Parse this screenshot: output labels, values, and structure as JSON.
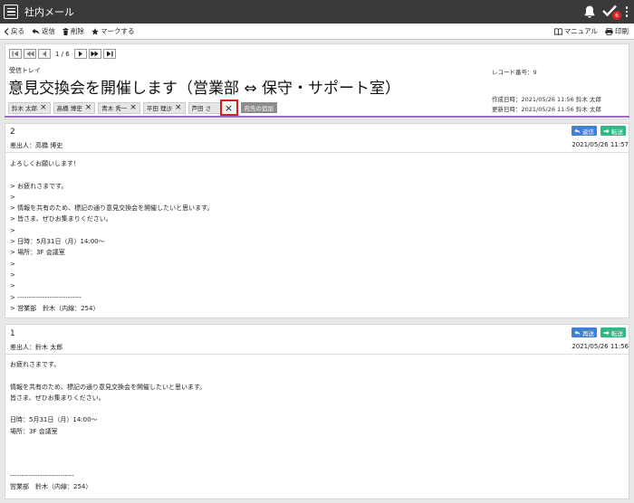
{
  "app": {
    "title": "社内メール",
    "badge_count": "6"
  },
  "toolbar": {
    "back": "戻る",
    "reply": "返信",
    "delete": "削除",
    "mark": "マークする",
    "manual": "マニュアル",
    "print": "印刷"
  },
  "pager": {
    "page": "1 / 6"
  },
  "mail": {
    "tray": "受信トレイ",
    "subject": "意見交換会を開催します（営業部 ⇔ 保守・サポート室）",
    "record_no": "レコード番号：9",
    "created": "作成日時：2021/05/26 11:56 鈴木 太郎",
    "updated": "更新日時：2021/05/26 11:56 鈴木 太郎",
    "recipients": [
      "鈴木 太郎",
      "高橋 博史",
      "青木 秀一",
      "平田 理沙",
      "芦田 さ"
    ],
    "add_destination": "宛先の追加"
  },
  "messages": [
    {
      "number": "2",
      "from": "差出人：高橋 博史",
      "date": "2021/05/26 11:57",
      "reply_label": "返信",
      "forward_label": "転送",
      "body": "よろしくお願いします！\n\n> お疲れさまです。\n>\n> 情報を共有のため、標記の通り意見交換会を開催したいと思います。\n> 皆さま、ぜひお集まりください。\n>\n> 日時：5月31日（月）14:00～\n> 場所：3F 会議室\n>\n>\n>\n> ----------------------------\n> 営業部　鈴木（内線：254）"
    },
    {
      "number": "1",
      "from": "差出人：鈴木 太郎",
      "date": "2021/05/26 11:56",
      "reply_label": "再送",
      "forward_label": "転送",
      "body": "お疲れさまです。\n\n情報を共有のため、標記の通り意見交換会を開催したいと思います。\n皆さま、ぜひお集まりください。\n\n日時：5月31日（月）14:00～\n場所：3F 会議室\n\n\n\n----------------------------\n営業部　鈴木（内線：254）"
    }
  ]
}
